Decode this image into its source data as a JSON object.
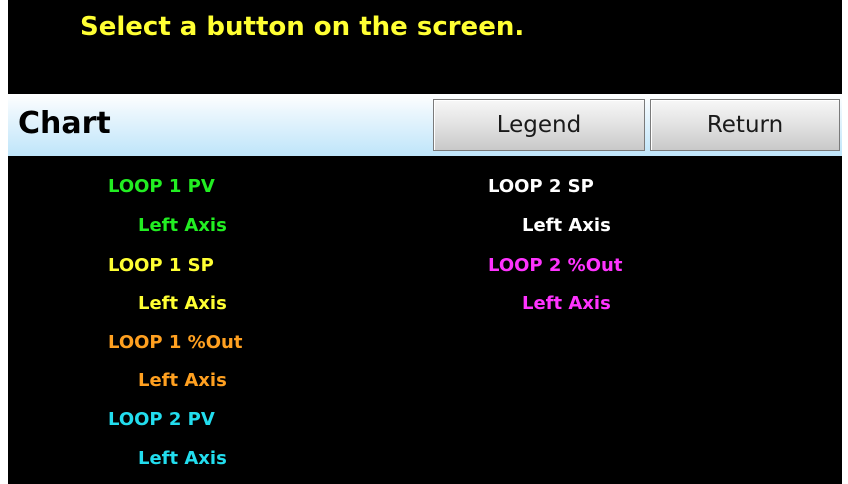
{
  "prompt": "Select a button on the screen.",
  "header": {
    "title": "Chart",
    "legend_label": "Legend",
    "return_label": "Return"
  },
  "legend": {
    "column_left": [
      {
        "name": "LOOP 1 PV",
        "axis": "Left Axis",
        "color": "#22ee22"
      },
      {
        "name": "LOOP 1 SP",
        "axis": "Left Axis",
        "color": "#ffff33"
      },
      {
        "name": "LOOP 1 %Out",
        "axis": "Left Axis",
        "color": "#ffa020"
      },
      {
        "name": "LOOP 2 PV",
        "axis": "Left Axis",
        "color": "#22ddee"
      }
    ],
    "column_right": [
      {
        "name": "LOOP 2 SP",
        "axis": "Left Axis",
        "color": "#ffffff"
      },
      {
        "name": "LOOP 2 %Out",
        "axis": "Left Axis",
        "color": "#ff33ff"
      }
    ]
  }
}
